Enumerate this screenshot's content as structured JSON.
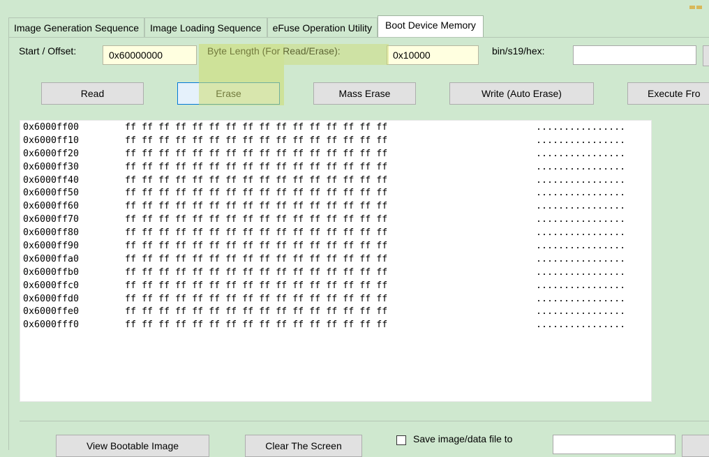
{
  "tabs": [
    {
      "label": "Image Generation Sequence",
      "active": false
    },
    {
      "label": "Image Loading Sequence",
      "active": false
    },
    {
      "label": "eFuse Operation Utility",
      "active": false
    },
    {
      "label": "Boot Device Memory",
      "active": true
    }
  ],
  "form": {
    "start_label": "Start / Offset:",
    "start_value": "0x60000000",
    "length_label": "Byte Length (For Read/Erase):",
    "length_value": "0x10000",
    "file_label": "bin/s19/hex:",
    "file_value": ""
  },
  "buttons": {
    "read": "Read",
    "erase": "Erase",
    "mass_erase": "Mass Erase",
    "write": "Write (Auto Erase)",
    "execute": "Execute Fro"
  },
  "memory": {
    "rows": [
      {
        "addr": "0x6000ff00",
        "bytes": "ff ff ff ff ff ff ff ff ff ff ff ff ff ff ff ff",
        "ascii": "................"
      },
      {
        "addr": "0x6000ff10",
        "bytes": "ff ff ff ff ff ff ff ff ff ff ff ff ff ff ff ff",
        "ascii": "................"
      },
      {
        "addr": "0x6000ff20",
        "bytes": "ff ff ff ff ff ff ff ff ff ff ff ff ff ff ff ff",
        "ascii": "................"
      },
      {
        "addr": "0x6000ff30",
        "bytes": "ff ff ff ff ff ff ff ff ff ff ff ff ff ff ff ff",
        "ascii": "................"
      },
      {
        "addr": "0x6000ff40",
        "bytes": "ff ff ff ff ff ff ff ff ff ff ff ff ff ff ff ff",
        "ascii": "................"
      },
      {
        "addr": "0x6000ff50",
        "bytes": "ff ff ff ff ff ff ff ff ff ff ff ff ff ff ff ff",
        "ascii": "................"
      },
      {
        "addr": "0x6000ff60",
        "bytes": "ff ff ff ff ff ff ff ff ff ff ff ff ff ff ff ff",
        "ascii": "................"
      },
      {
        "addr": "0x6000ff70",
        "bytes": "ff ff ff ff ff ff ff ff ff ff ff ff ff ff ff ff",
        "ascii": "................"
      },
      {
        "addr": "0x6000ff80",
        "bytes": "ff ff ff ff ff ff ff ff ff ff ff ff ff ff ff ff",
        "ascii": "................"
      },
      {
        "addr": "0x6000ff90",
        "bytes": "ff ff ff ff ff ff ff ff ff ff ff ff ff ff ff ff",
        "ascii": "................"
      },
      {
        "addr": "0x6000ffa0",
        "bytes": "ff ff ff ff ff ff ff ff ff ff ff ff ff ff ff ff",
        "ascii": "................"
      },
      {
        "addr": "0x6000ffb0",
        "bytes": "ff ff ff ff ff ff ff ff ff ff ff ff ff ff ff ff",
        "ascii": "................"
      },
      {
        "addr": "0x6000ffc0",
        "bytes": "ff ff ff ff ff ff ff ff ff ff ff ff ff ff ff ff",
        "ascii": "................"
      },
      {
        "addr": "0x6000ffd0",
        "bytes": "ff ff ff ff ff ff ff ff ff ff ff ff ff ff ff ff",
        "ascii": "................"
      },
      {
        "addr": "0x6000ffe0",
        "bytes": "ff ff ff ff ff ff ff ff ff ff ff ff ff ff ff ff",
        "ascii": "................"
      },
      {
        "addr": "0x6000fff0",
        "bytes": "ff ff ff ff ff ff ff ff ff ff ff ff ff ff ff ff",
        "ascii": "................"
      }
    ]
  },
  "bottom": {
    "view_bootable": "View Bootable Image",
    "clear_screen": "Clear The Screen",
    "save_checkbox_label": "Save image/data file to",
    "save_checked": false,
    "save_path": ""
  },
  "colors": {
    "background": "#cfe8cf",
    "field_yellow": "#ffffe0",
    "highlight": "#cddc6e"
  }
}
